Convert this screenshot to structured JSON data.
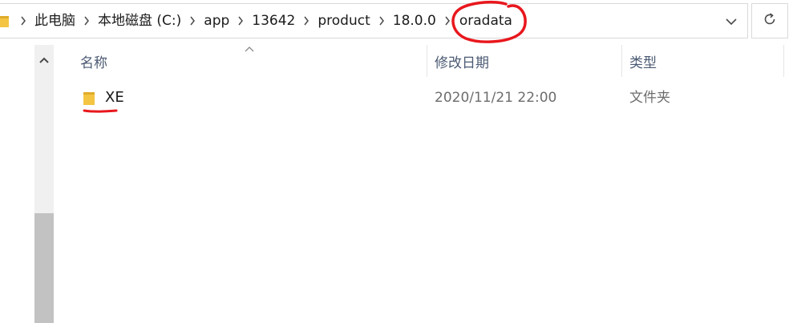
{
  "address_bar": {
    "breadcrumbs": [
      {
        "label": "此电脑"
      },
      {
        "label": "本地磁盘 (C:)"
      },
      {
        "label": "app"
      },
      {
        "label": "13642"
      },
      {
        "label": "product"
      },
      {
        "label": "18.0.0"
      },
      {
        "label": "oradata"
      }
    ],
    "annotation_color": "#e8171d"
  },
  "icons": {
    "folder": "folder-icon",
    "breadcrumb_separator": "chevron-right-icon",
    "dropdown": "chevron-down-icon",
    "refresh": "refresh-icon",
    "scroll_up": "chevron-up-icon",
    "sort": "sort-ascending-icon"
  },
  "columns": {
    "name": "名称",
    "date_modified": "修改日期",
    "type": "类型"
  },
  "files": [
    {
      "name": "XE",
      "date_modified": "2020/11/21 22:00",
      "type": "文件夹"
    }
  ],
  "colors": {
    "folder_yellow": "#f4c542",
    "header_text": "#4b5a73",
    "secondary_text": "#6d6d6d",
    "border": "#d9d9d9",
    "scroll_track": "#f0f0f0",
    "scroll_thumb": "#c2c2c2"
  }
}
